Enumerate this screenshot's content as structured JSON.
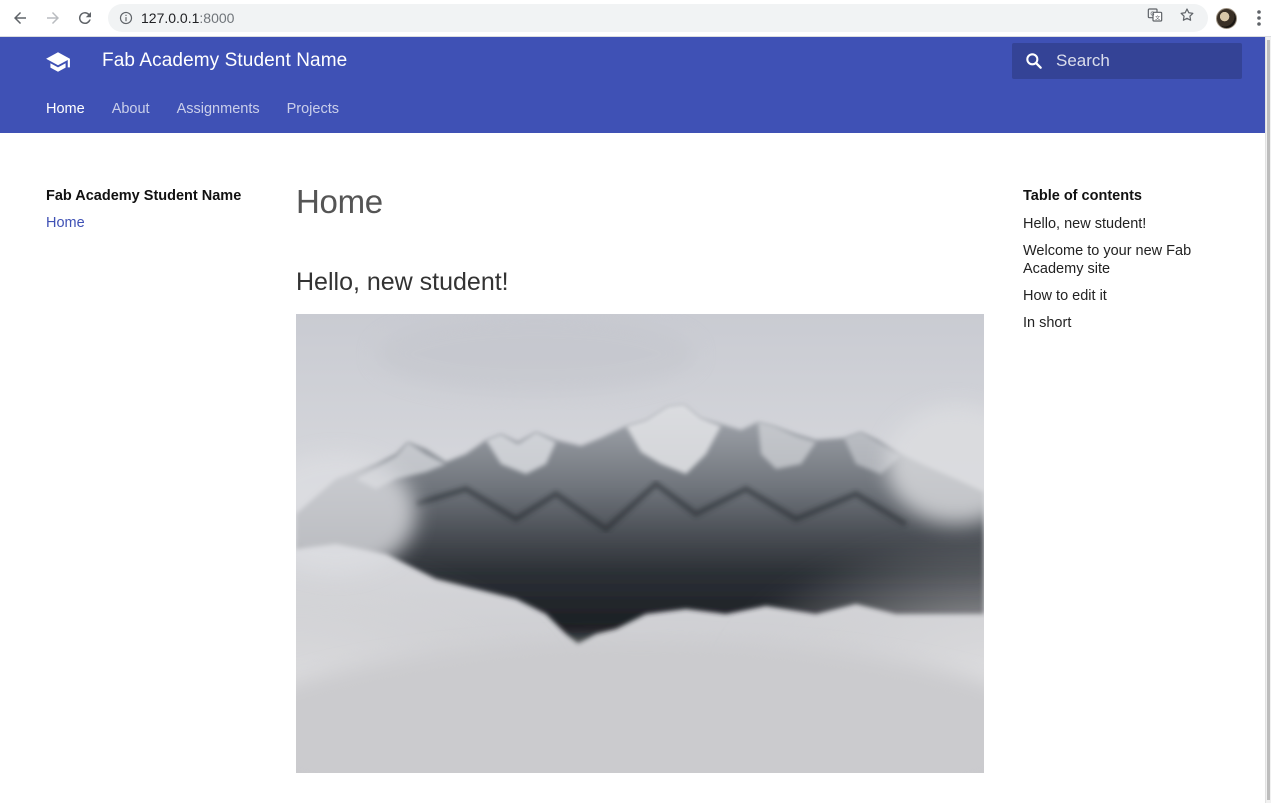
{
  "browser": {
    "url_host": "127.0.0.1",
    "url_port": ":8000",
    "icons": [
      "back-arrow-icon",
      "forward-arrow-icon",
      "reload-icon",
      "info-icon",
      "translate-icon",
      "star-icon",
      "avatar",
      "more-vert-icon"
    ]
  },
  "header": {
    "site_title": "Fab Academy Student Name",
    "search_placeholder": "Search",
    "tabs": [
      "Home",
      "About",
      "Assignments",
      "Projects"
    ],
    "active_tab": "Home",
    "color": "#3f51b5"
  },
  "left_nav": {
    "title": "Fab Academy Student Name",
    "items": [
      "Home"
    ]
  },
  "main": {
    "page_title": "Home",
    "section_title": "Hello, new student!",
    "image": "snowy-mountain-in-clouds"
  },
  "toc": {
    "title": "Table of contents",
    "items": [
      "Hello, new student!",
      "Welcome to your new Fab Academy site",
      "How to edit it",
      "In short"
    ]
  }
}
